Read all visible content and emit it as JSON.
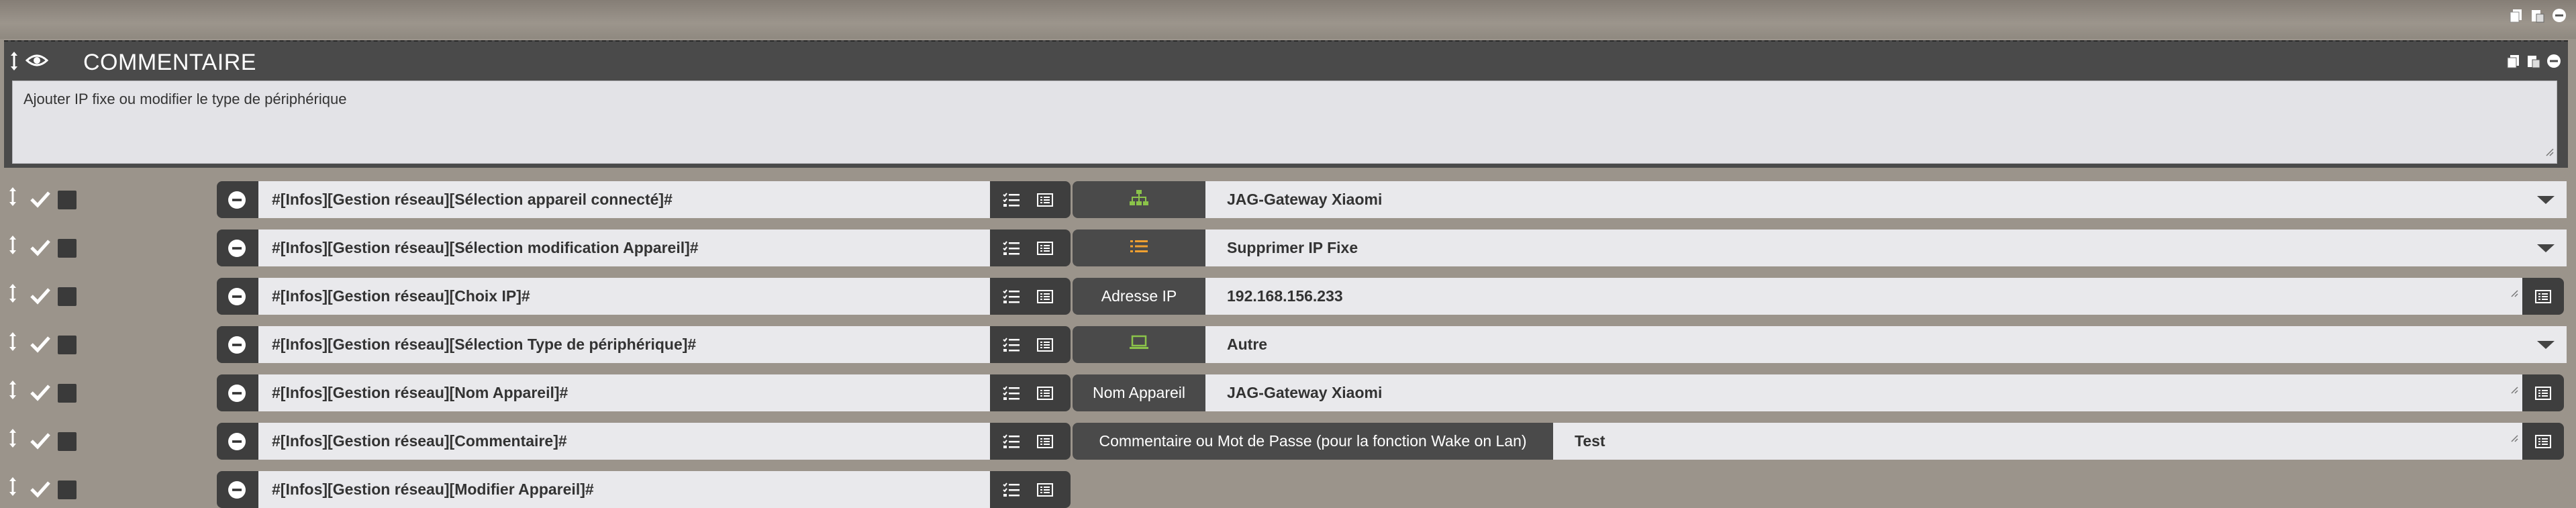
{
  "block": {
    "title": "COMMENTAIRE",
    "comment": "Ajouter IP fixe ou modifier le type de périphérique"
  },
  "rows": [
    {
      "expression": "#[Infos][Gestion réseau][Sélection appareil connecté]#",
      "label": "",
      "label_icon": "network-icon",
      "label_icon_color": "#8bc34a",
      "value": "JAG-Gateway Xiaomi",
      "kind": "select"
    },
    {
      "expression": "#[Infos][Gestion réseau][Sélection modification Appareil]#",
      "label": "",
      "label_icon": "list-icon",
      "label_icon_color": "#f0a030",
      "value": "Supprimer IP Fixe",
      "kind": "select"
    },
    {
      "expression": "#[Infos][Gestion réseau][Choix IP]#",
      "label": "Adresse IP",
      "value": "192.168.156.233",
      "kind": "text"
    },
    {
      "expression": "#[Infos][Gestion réseau][Sélection Type de périphérique]#",
      "label": "",
      "label_icon": "laptop-icon",
      "label_icon_color": "#8bc34a",
      "value": "Autre",
      "kind": "select"
    },
    {
      "expression": "#[Infos][Gestion réseau][Nom Appareil]#",
      "label": "Nom Appareil",
      "value": "JAG-Gateway Xiaomi",
      "kind": "text"
    },
    {
      "expression": "#[Infos][Gestion réseau][Commentaire]#",
      "label": "Commentaire ou Mot de Passe (pour la fonction Wake on Lan)",
      "value": "Test",
      "kind": "text"
    },
    {
      "expression": "#[Infos][Gestion réseau][Modifier Appareil]#",
      "kind": "none"
    }
  ],
  "colors": {
    "background": "#9b948b",
    "block_header": "#4a4a4a",
    "input": "#e9e9ec",
    "icon_green": "#8bc34a",
    "icon_orange": "#f0a030"
  }
}
